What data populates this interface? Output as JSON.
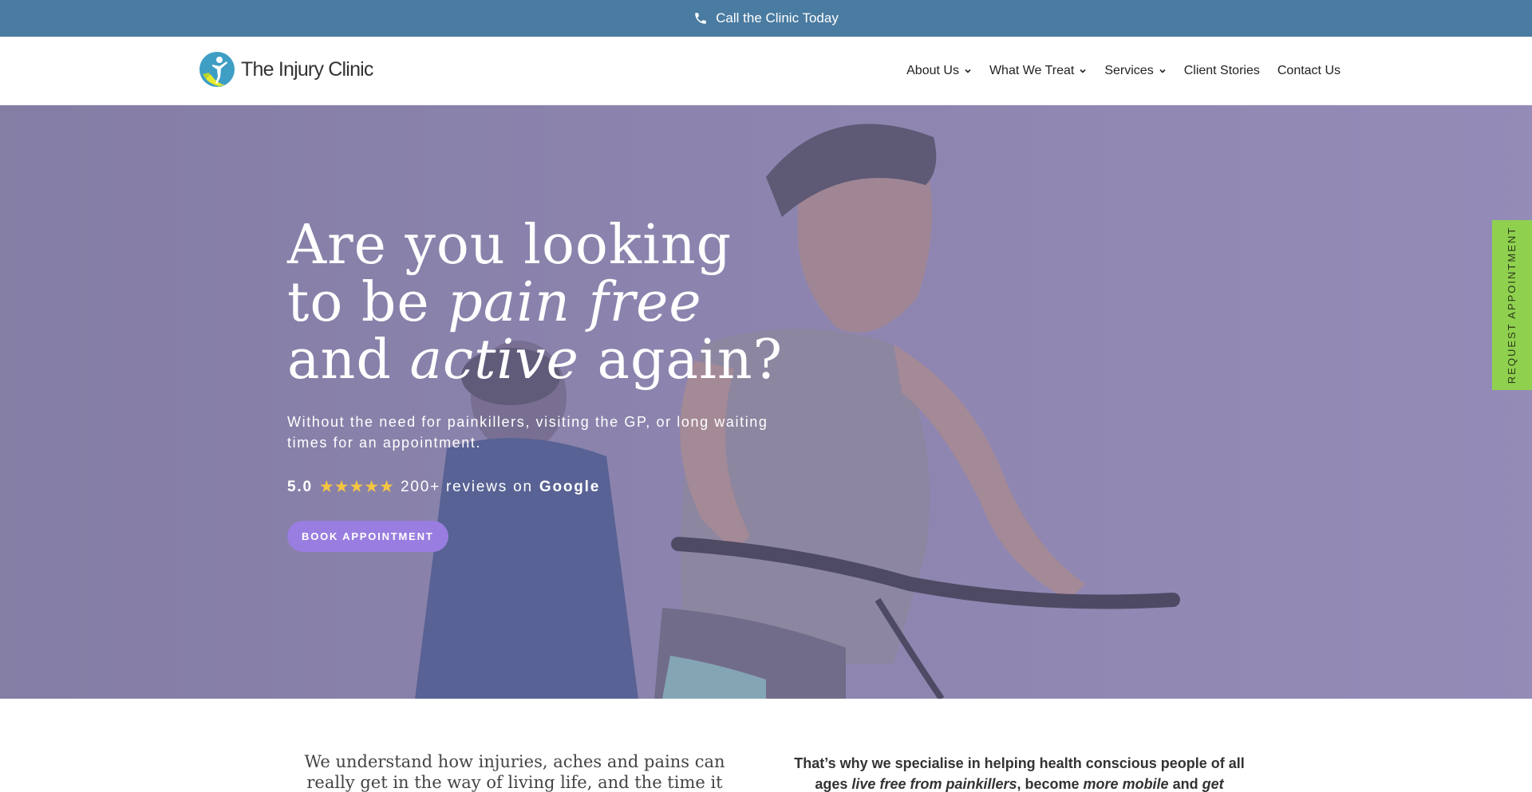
{
  "topbar": {
    "call_label": "Call the Clinic Today",
    "icon": "phone-icon"
  },
  "header": {
    "logo_text": "The Injury Clinic",
    "nav": [
      {
        "label": "About Us",
        "has_dropdown": true
      },
      {
        "label": "What We Treat",
        "has_dropdown": true
      },
      {
        "label": "Services",
        "has_dropdown": true
      },
      {
        "label": "Client Stories",
        "has_dropdown": false
      },
      {
        "label": "Contact Us",
        "has_dropdown": false
      }
    ]
  },
  "hero": {
    "title_line1": "Are you looking",
    "title_line2_a": "to be ",
    "title_line2_em": "pain free",
    "title_line3_a": "and ",
    "title_line3_em": "active",
    "title_line3_b": " again?",
    "subtitle": "Without the need for painkillers, visiting the GP, or long waiting times for an appointment.",
    "rating": "5.0",
    "stars": "★★★★★",
    "reviews_text": "200+ reviews on",
    "reviews_source": "Google",
    "cta": "BOOK APPOINTMENT"
  },
  "side_tab": {
    "label": "REQUEST APPOINTMENT"
  },
  "intro": {
    "left_text": "We understand how injuries, aches and pains can really get in the way of living life, and the time it",
    "right_a": "That’s why we specialise in helping health conscious people of all ages ",
    "right_em1": "live free from painkillers",
    "right_b": ", become ",
    "right_em2": "more mobile",
    "right_c": " and ",
    "right_em3": "get"
  },
  "colors": {
    "topbar": "#4a7ba1",
    "hero_overlay": "#8c80b4",
    "cta": "#9a7de0",
    "side_tab": "#8fd14f",
    "stars": "#f5c542"
  }
}
